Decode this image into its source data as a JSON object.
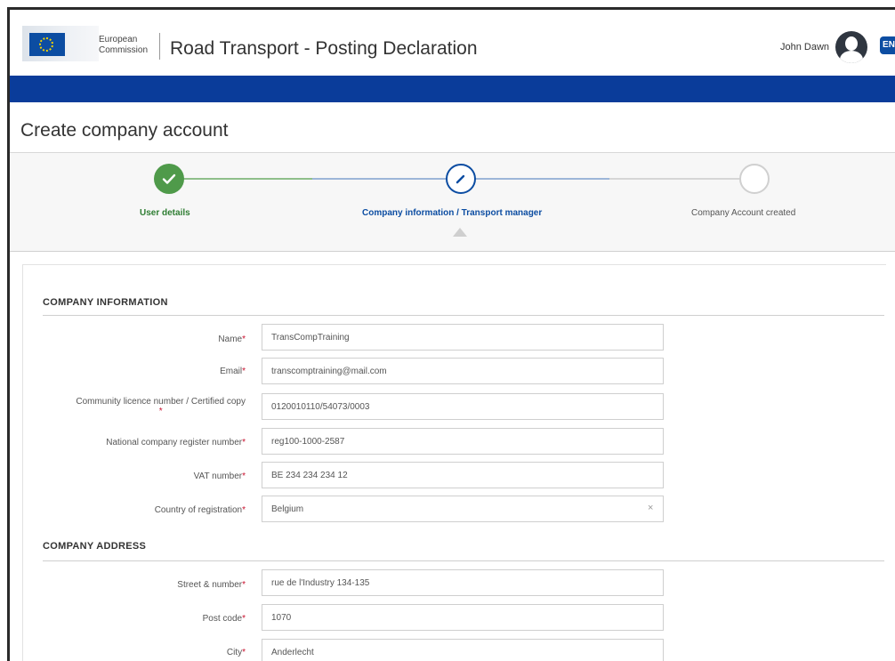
{
  "header": {
    "eu_label_line1": "European",
    "eu_label_line2": "Commission",
    "app_title": "Road Transport - Posting Declaration",
    "user_name": "John Dawn",
    "language": "EN"
  },
  "page_title": "Create company account",
  "stepper": {
    "steps": [
      {
        "label": "User details",
        "state": "done"
      },
      {
        "label": "Company information / Transport manager",
        "state": "current"
      },
      {
        "label": "Company Account created",
        "state": "pending"
      }
    ],
    "colors": {
      "done": "#4f9a4a",
      "current": "#0c4da2",
      "pending": "#cfcfcf"
    }
  },
  "sections": {
    "company_information": "COMPANY INFORMATION",
    "company_address": "COMPANY ADDRESS"
  },
  "fields": {
    "name": {
      "label": "Name",
      "value": "TransCompTraining"
    },
    "email": {
      "label": "Email",
      "value": "transcomptraining@mail.com"
    },
    "licence": {
      "label": "Community licence number / Certified copy",
      "value": "0120010110/54073/0003"
    },
    "register": {
      "label": "National company register number",
      "value": "reg100-1000-2587"
    },
    "vat": {
      "label": "VAT number",
      "value": "BE 234 234 234 12"
    },
    "country": {
      "label": "Country of registration",
      "value": "Belgium"
    },
    "street": {
      "label": "Street & number",
      "value": "rue de l'Industry 134-135"
    },
    "postcode": {
      "label": "Post code",
      "value": "1070"
    },
    "city": {
      "label": "City",
      "value": "Anderlecht"
    }
  },
  "required_marker": "*",
  "clear_icon": "×"
}
